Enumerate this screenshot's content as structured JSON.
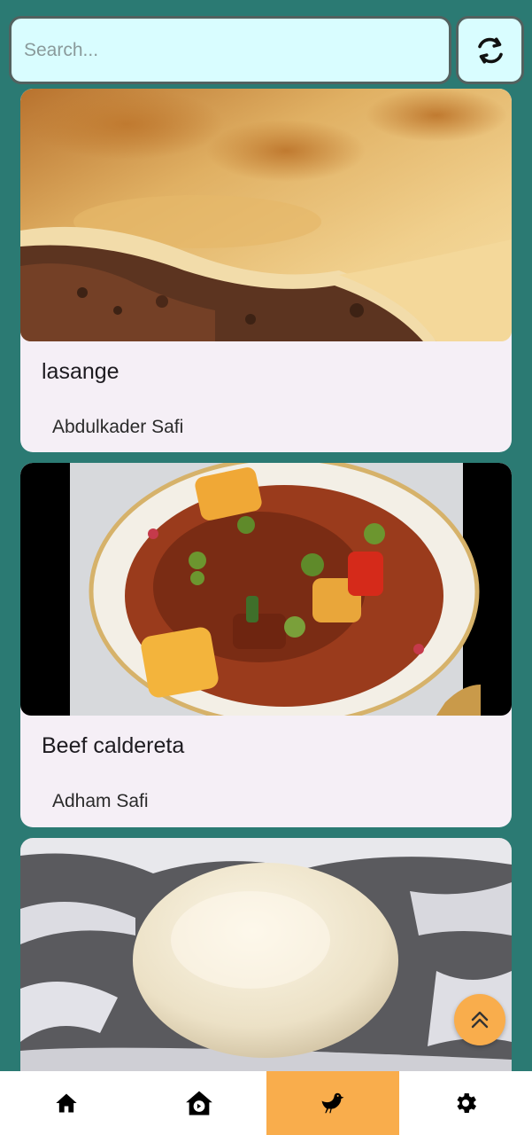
{
  "search": {
    "placeholder": "Search..."
  },
  "toolbar": {
    "refresh_icon": "refresh-icon"
  },
  "recipes": [
    {
      "title": "lasange",
      "author": "Abdulkader Safi",
      "image": "lasagna-photo"
    },
    {
      "title": "Beef caldereta",
      "author": "Adham Safi",
      "image": "beef-stew-photo"
    },
    {
      "title": "",
      "author": "",
      "image": "dough-photo"
    }
  ],
  "bottom_nav": {
    "items": [
      {
        "icon": "home-icon",
        "active": false
      },
      {
        "icon": "house-recipe-icon",
        "active": false
      },
      {
        "icon": "chicken-icon",
        "active": true
      },
      {
        "icon": "gear-icon",
        "active": false
      }
    ]
  },
  "colors": {
    "background": "#2b7a73",
    "search_bg": "#d9fdff",
    "card_bg": "#f5eff6",
    "accent": "#f9ad4c"
  }
}
